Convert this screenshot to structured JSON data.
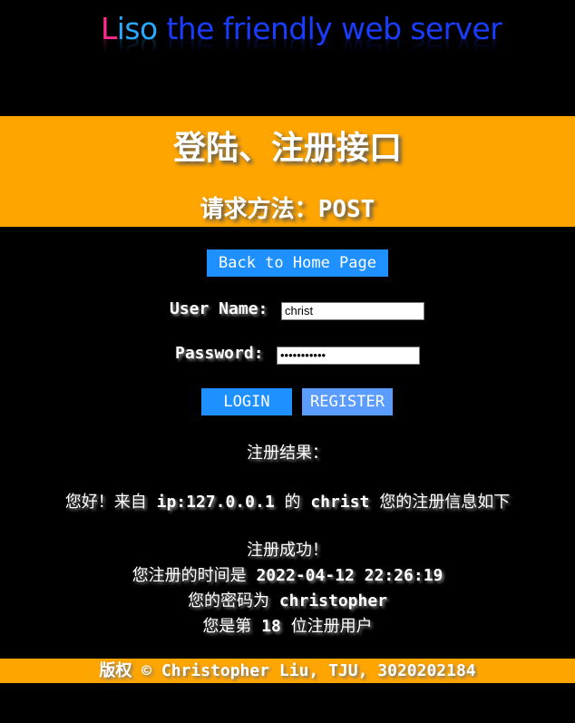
{
  "logo": {
    "part1": "L",
    "part2": "iso",
    "part3": " the friendly web server"
  },
  "banner": {
    "title": "登陆、注册接口",
    "method_label": "请求方法：",
    "method_value": "POST"
  },
  "nav": {
    "home_label": "Back to Home Page"
  },
  "form": {
    "username_label": "User Name:",
    "username_value": "christ",
    "password_label": "Password:",
    "password_value": "•••••••••••",
    "login_label": "LOGIN",
    "register_label": "REGISTER"
  },
  "result": {
    "heading": "注册结果：",
    "greeting_prefix": "您好！来自 ",
    "greeting_ip": "ip:127.0.0.1",
    "greeting_mid": " 的 ",
    "greeting_user": "christ",
    "greeting_suffix": " 您的注册信息如下",
    "success": "注册成功！",
    "time_prefix": "您注册的时间是 ",
    "time_value": "2022-04-12 22:26:19",
    "password_prefix": "您的密码为 ",
    "password_value": "christopher",
    "rank_prefix": "您是第 ",
    "rank_value": "18",
    "rank_suffix": " 位注册用户"
  },
  "footer": {
    "copyright": "版权 © Christopher Liu, TJU, 3020202184"
  },
  "colors": {
    "banner_bg": "#ffa500",
    "button_blue": "#1e90ff",
    "register_blue": "#5b9cff",
    "logo_pink": "#ff2d8e",
    "logo_cyan": "#2aa8ff",
    "logo_blue": "#1a3cff"
  }
}
